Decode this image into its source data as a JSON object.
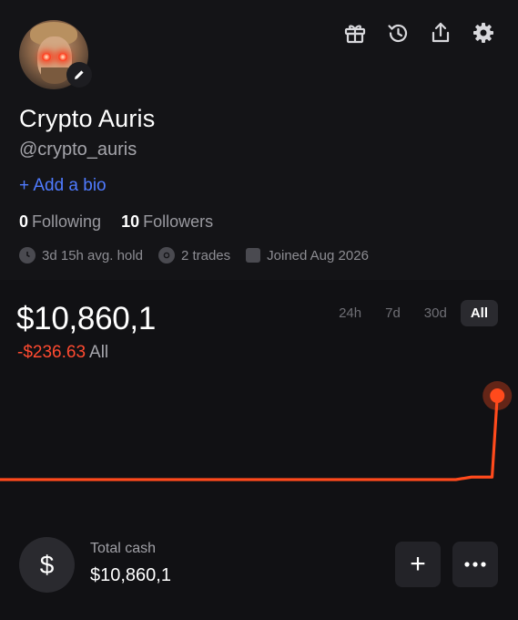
{
  "profile": {
    "name": "Crypto Auris",
    "handle": "@crypto_auris",
    "add_bio": "+ Add a bio",
    "following_count": "0",
    "following_label": "Following",
    "followers_count": "10",
    "followers_label": "Followers",
    "stats": {
      "avg_hold": "3d 15h avg. hold",
      "trades": "2 trades",
      "joined": "Joined Aug 2026"
    }
  },
  "header_icons": [
    "gift-icon",
    "history-icon",
    "share-icon",
    "settings-icon"
  ],
  "portfolio": {
    "balance": "$10,860,1",
    "pnl": "-$236.63",
    "pnl_range": "All",
    "tabs": [
      "24h",
      "7d",
      "30d",
      "All"
    ],
    "active_tab": "All"
  },
  "chart_data": {
    "type": "line",
    "color": "#ff4a1c",
    "title": "",
    "xlabel": "",
    "ylabel": "",
    "points": [
      [
        0,
        0
      ],
      [
        0.88,
        0
      ],
      [
        0.91,
        0.03
      ],
      [
        0.95,
        0.03
      ],
      [
        0.96,
        1
      ]
    ],
    "ylim": [
      0,
      1
    ],
    "grid": false
  },
  "cash": {
    "symbol": "$",
    "label": "Total cash",
    "value": "$10,860,1"
  },
  "actions": {
    "plus": "+"
  },
  "colors": {
    "accent_blue": "#4f7bff",
    "negative_red": "#ff4a30",
    "line_orange": "#ff4a1c"
  }
}
